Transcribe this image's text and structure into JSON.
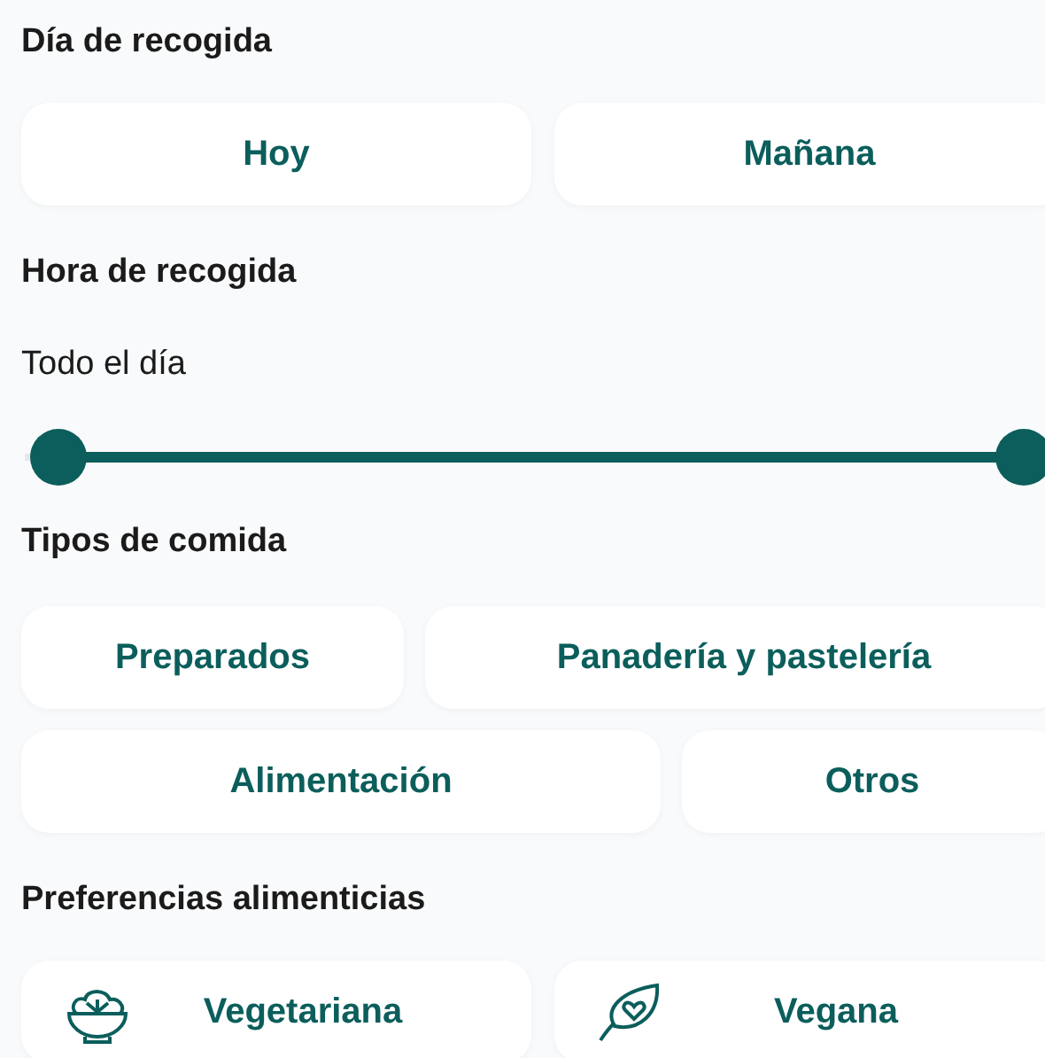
{
  "pickup_day": {
    "title": "Día de recogida",
    "options": [
      {
        "label": "Hoy",
        "selected": false
      },
      {
        "label": "Mañana",
        "selected": false
      }
    ]
  },
  "pickup_time": {
    "title": "Hora de recogida",
    "reading": "Todo el día",
    "range": {
      "low": {
        "level": 0
      },
      "high": {
        "level": 1
      }
    }
  },
  "food_types": {
    "title": "Tipos de comida",
    "rows": [
      [
        {
          "label": "Preparados",
          "selected": false
        },
        {
          "label": "Panadería y pastelería",
          "selected": false
        }
      ],
      [
        {
          "label": "Alimentación",
          "selected": false
        },
        {
          "label": "Otros",
          "selected": false
        }
      ]
    ]
  },
  "preferences": {
    "title": "Preferencias alimenticias",
    "options": [
      {
        "label": "Vegetariana",
        "selected": false
      },
      {
        "label": "Vegana",
        "selected": false
      }
    ]
  }
}
